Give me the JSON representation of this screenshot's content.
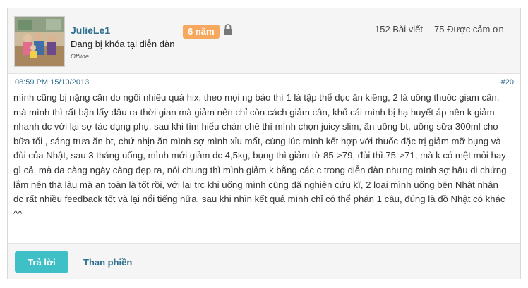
{
  "user": {
    "name": "JulieLe1",
    "tenure_badge": "6 năm",
    "status": "Đang bị khóa tại diễn đàn",
    "online": "Offline",
    "posts": "152 Bài viết",
    "likes": "75 Được cảm ơn",
    "badge_color": "#f6a95e"
  },
  "post": {
    "date": "08:59 PM 15/10/2013",
    "number": "#20",
    "body": "mình cũng bị nặng cân do ngồi nhiều quá hix, theo mọi ng bảo thì 1 là tập thể dục ăn kiêng, 2 là uống thuốc giam cân, mà mình thì rất bận lấy đâu ra thời gian mà giảm nên chỉ còn cách giảm cân, khổ cái mình bị hạ huyết áp nên k giảm nhanh dc với lại sợ tác dụng phụ, sau khi tìm hiểu chán chê thì mình chọn juicy slim, ăn uống bt, uống sữa 300ml cho bữa tối , sáng trưa ăn bt, chứ nhịn ăn mình sợ mình xỉu mất, cùng lúc mình kết hợp với thuốc đặc trị giảm mỡ bụng và đùi của Nhật, sau 3 tháng uống, mình mới giảm dc 4,5kg, bụng thì giảm từ 85->79, đùi thì 75->71, mà k có mệt mỏi hay gì cả, mà da càng ngày càng đẹp ra, nói chung thì mình giảm k bằng các c trong diễn đàn nhưng mình sợ hậu di chứng lắm nên thà lâu mà an toàn là tốt rồi, với lại trc khi uống mình cũng đã nghiên cứu kĩ, 2 loại mình uống bên Nhật nhận dc rất nhiều feedback tốt và lại nổi tiếng nữa, sau khi nhìn kết quả mình chỉ có thể phán 1 câu, đúng là đồ Nhật có khác ^^"
  },
  "actions": {
    "reply_label": "Trả lời",
    "report_label": "Than phiền",
    "accent_color": "#3fbfc6"
  },
  "icons": {
    "lock": "lock-icon",
    "avatar": "avatar-photo"
  }
}
